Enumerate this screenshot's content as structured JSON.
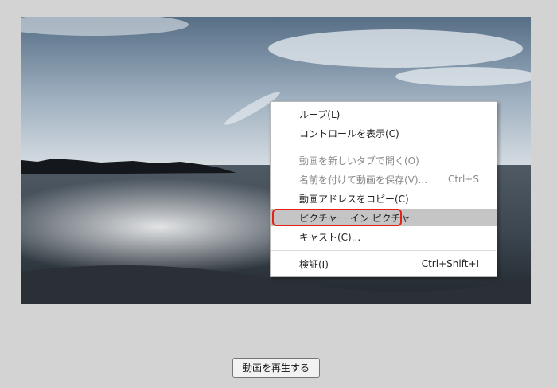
{
  "context_menu": {
    "items": [
      {
        "label": "ループ(L)",
        "shortcut": "",
        "disabled": false
      },
      {
        "label": "コントロールを表示(C)",
        "shortcut": "",
        "disabled": false
      },
      {
        "label": "動画を新しいタブで開く(O)",
        "shortcut": "",
        "disabled": true
      },
      {
        "label": "名前を付けて動画を保存(V)...",
        "shortcut": "Ctrl+S",
        "disabled": true
      },
      {
        "label": "動画アドレスをコピー(C)",
        "shortcut": "",
        "disabled": false
      },
      {
        "label": "ピクチャー イン ピクチャー",
        "shortcut": "",
        "disabled": false,
        "highlighted": true
      },
      {
        "label": "キャスト(C)...",
        "shortcut": "",
        "disabled": false
      },
      {
        "label": "検証(I)",
        "shortcut": "Ctrl+Shift+I",
        "disabled": false
      }
    ]
  },
  "play_button": {
    "label": "動画を再生する"
  },
  "colors": {
    "annotation_ring": "#e2231a",
    "menu_highlight": "#c5c5c5"
  }
}
